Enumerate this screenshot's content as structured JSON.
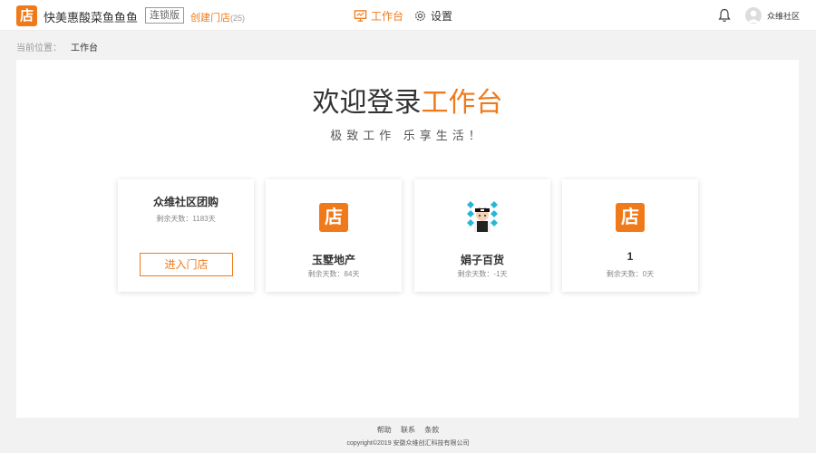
{
  "header": {
    "logo_char": "店",
    "store_name": "快美惠酸菜鱼鱼鱼",
    "chain_badge": "连锁版",
    "create_store_label": "创建门店",
    "create_store_count": "(25)",
    "nav": {
      "workbench": "工作台",
      "settings": "设置"
    },
    "username": "众维社区"
  },
  "breadcrumb": {
    "label": "当前位置：",
    "current": "工作台"
  },
  "main": {
    "welcome_prefix": "欢迎登录",
    "welcome_accent": "工作台",
    "slogan": "极致工作  乐享生活！"
  },
  "stores": [
    {
      "name": "众维社区团购",
      "days": "剩余天数：1183天",
      "button": "进入门店",
      "logo": "none"
    },
    {
      "name": "玉墅地产",
      "days": "剩余天数：84天",
      "logo": "店"
    },
    {
      "name": "娟子百货",
      "days": "剩余天数：-1天",
      "logo": "avatar-image"
    },
    {
      "name": "1",
      "days": "剩余天数：0天",
      "logo": "店"
    }
  ],
  "footer": {
    "links": [
      "帮助",
      "联系",
      "条款"
    ],
    "copyright": "copyright©2019 安徽众维创汇科技有限公司"
  },
  "colors": {
    "accent": "#f07a1a",
    "background": "#f2f2f2"
  }
}
